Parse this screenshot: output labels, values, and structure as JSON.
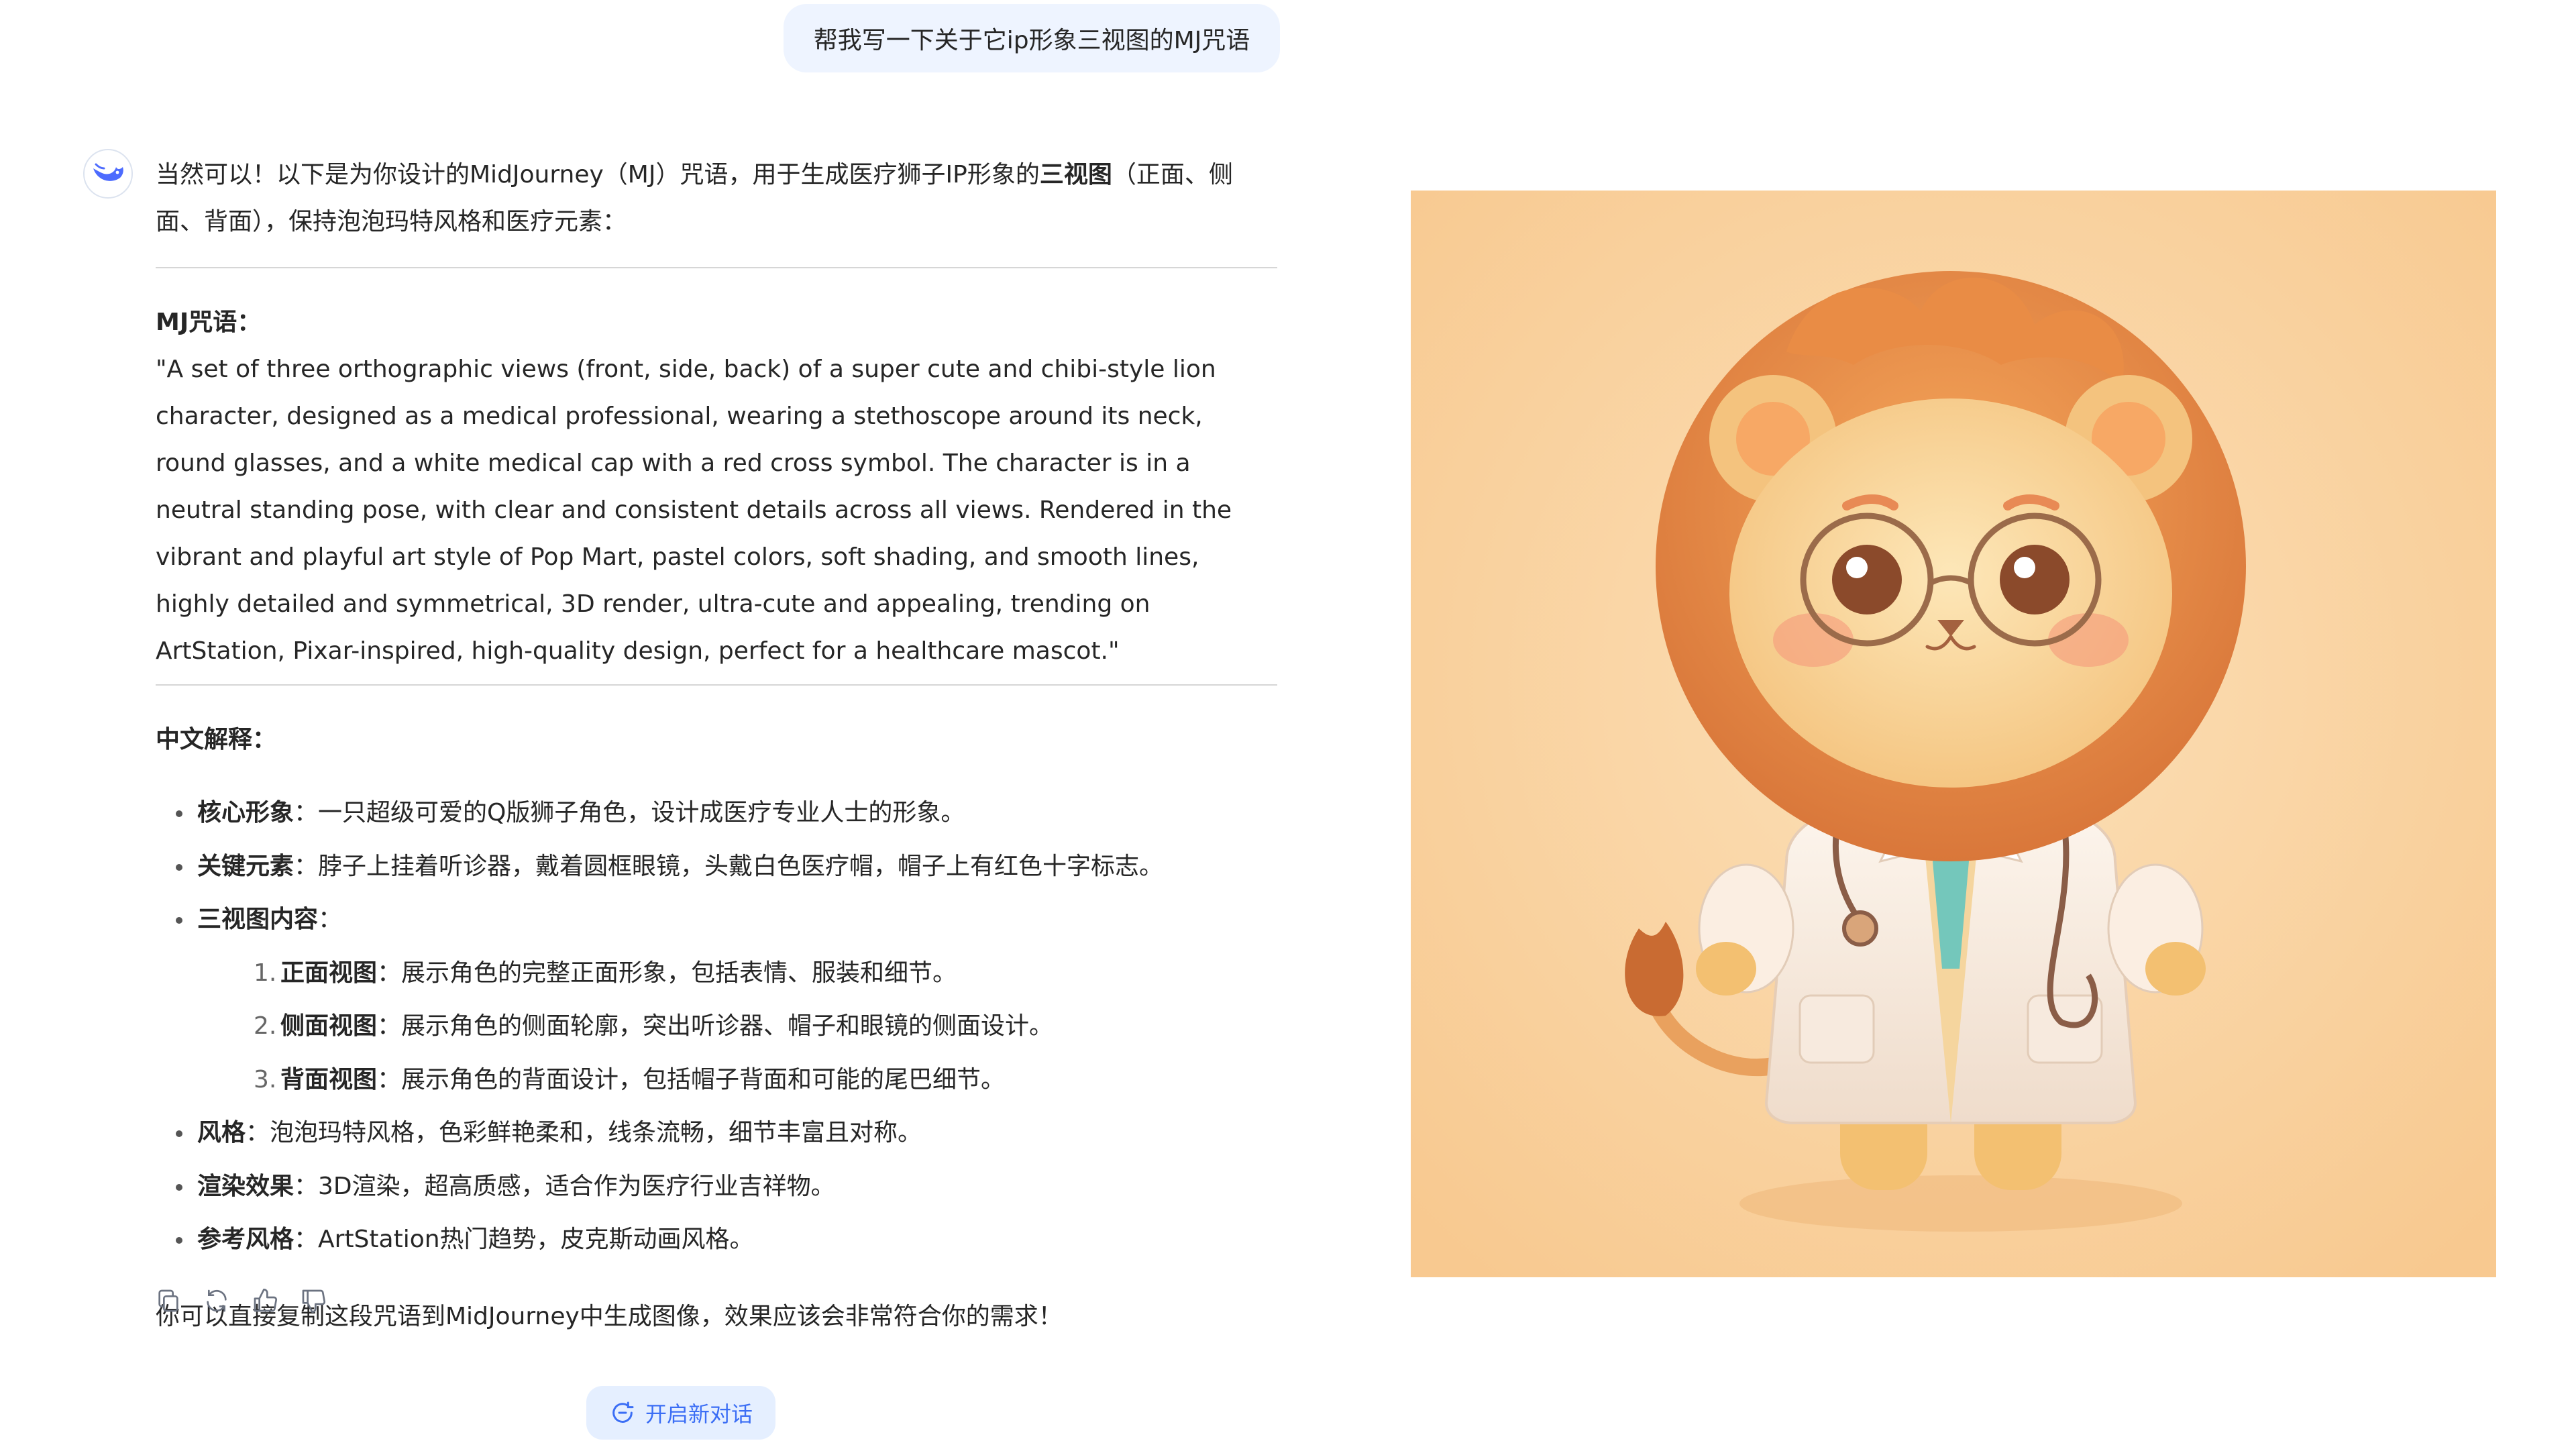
{
  "user_message": "帮我写一下关于它ip形象三视图的MJ咒语",
  "assistant": {
    "intro_pre": "当然可以！以下是为你设计的MidJourney（MJ）咒语，用于生成医疗狮子IP形象的",
    "intro_bold": "三视图",
    "intro_post": "（正面、侧面、背面），保持泡泡玛特风格和医疗元素：",
    "prompt_title": "MJ咒语：",
    "prompt_text": "\"A set of three orthographic views (front, side, back) of a super cute and chibi-style lion character, designed as a medical professional, wearing a stethoscope around its neck, round glasses, and a white medical cap with a red cross symbol. The character is in a neutral standing pose, with clear and consistent details across all views. Rendered in the vibrant and playful art style of Pop Mart, pastel colors, soft shading, and smooth lines, highly detailed and symmetrical, 3D render, ultra-cute and appealing, trending on ArtStation, Pixar-inspired, high-quality design, perfect for a healthcare mascot.\"",
    "explain_title": "中文解释：",
    "points": [
      {
        "label": "核心形象",
        "text": "：一只超级可爱的Q版狮子角色，设计成医疗专业人士的形象。"
      },
      {
        "label": "关键元素",
        "text": "：脖子上挂着听诊器，戴着圆框眼镜，头戴白色医疗帽，帽子上有红色十字标志。"
      },
      {
        "label": "三视图内容",
        "text": "："
      },
      {
        "label": "风格",
        "text": "：泡泡玛特风格，色彩鲜艳柔和，线条流畅，细节丰富且对称。"
      },
      {
        "label": "渲染效果",
        "text": "：3D渲染，超高质感，适合作为医疗行业吉祥物。"
      },
      {
        "label": "参考风格",
        "text": "：ArtStation热门趋势，皮克斯动画风格。"
      }
    ],
    "views": [
      {
        "num": "1.",
        "label": "正面视图",
        "text": "：展示角色的完整正面形象，包括表情、服装和细节。"
      },
      {
        "num": "2.",
        "label": "侧面视图",
        "text": "：展示角色的侧面轮廓，突出听诊器、帽子和眼镜的侧面设计。"
      },
      {
        "num": "3.",
        "label": "背面视图",
        "text": "：展示角色的背面设计，包括帽子背面和可能的尾巴细节。"
      }
    ],
    "closing": "你可以直接复制这段咒语到MidJourney中生成图像，效果应该会非常符合你的需求！"
  },
  "actions": [
    "copy-icon",
    "regenerate-icon",
    "thumbs-up-icon",
    "thumbs-down-icon"
  ],
  "new_chat_label": "开启新对话",
  "colors": {
    "accent": "#3b6ef5",
    "bubble_bg": "#eef4ff",
    "image_bg": "#f9cf98"
  }
}
